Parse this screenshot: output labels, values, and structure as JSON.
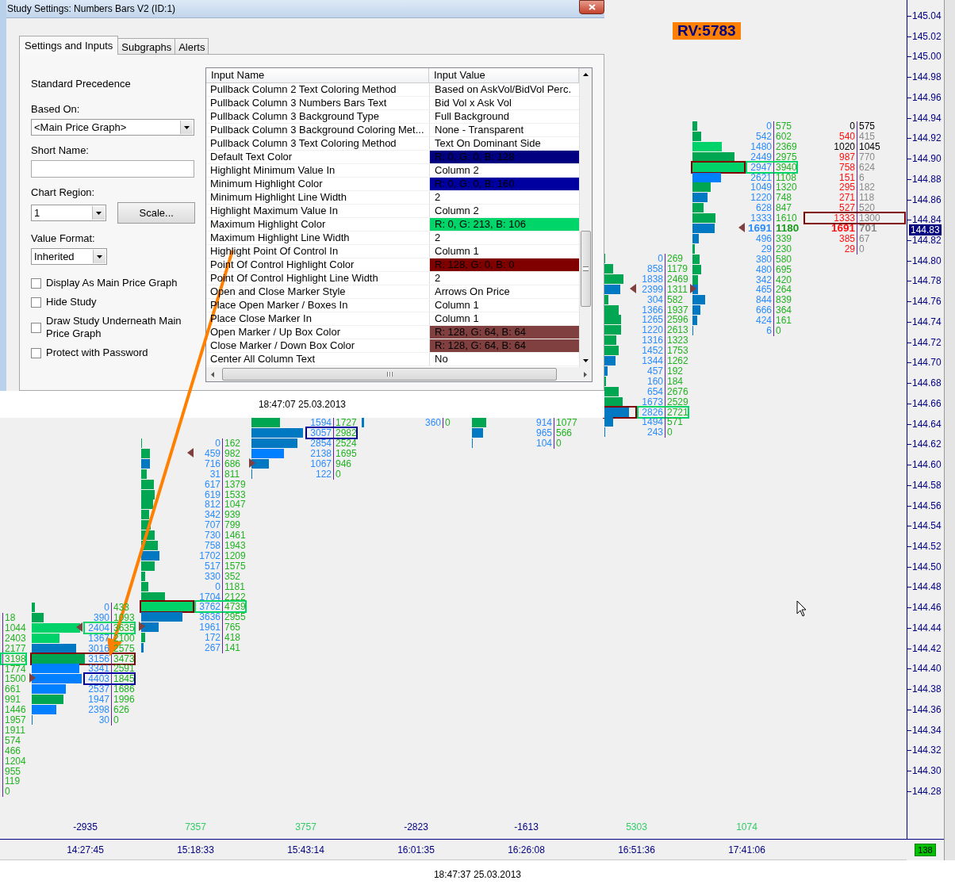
{
  "dialog": {
    "title": "Study Settings: Numbers Bars V2 (ID:1)",
    "tabs": [
      {
        "label": "Settings and Inputs",
        "selected": true
      },
      {
        "label": "Subgraphs",
        "selected": false
      },
      {
        "label": "Alerts",
        "selected": false
      }
    ],
    "form": {
      "heading": "Standard Precedence",
      "based_on": {
        "label": "Based On:",
        "value": "<Main Price Graph>"
      },
      "short_name": {
        "label": "Short Name:"
      },
      "chart_region": {
        "label": "Chart Region:",
        "value": "1"
      },
      "scale_button": "Scale...",
      "value_format": {
        "label": "Value Format:",
        "value": "Inherited"
      },
      "checkboxes": [
        {
          "label": "Display As Main Price Graph",
          "checked": false
        },
        {
          "label": "Hide Study",
          "checked": false
        },
        {
          "label": "Draw Study Underneath Main Price Graph",
          "checked": false
        },
        {
          "label": "Protect with Password",
          "checked": false
        }
      ]
    },
    "inputs_table": {
      "columns": [
        "Input Name",
        "Input Value"
      ],
      "rows": [
        {
          "name": "Pullback Column 2 Text Coloring Method",
          "value": "Based on AskVol/BidVol Perc."
        },
        {
          "name": "Pullback Column 3 Numbers Bars Text",
          "value": "Bid Vol x Ask Vol"
        },
        {
          "name": "Pullback Column 3 Background Type",
          "value": "Full Background"
        },
        {
          "name": "Pullback Column 3 Background Coloring Met...",
          "value": "None - Transparent"
        },
        {
          "name": "Pullback Column 3 Text Coloring Method",
          "value": "Text On Dominant Side"
        },
        {
          "name": "Default Text Color",
          "value": "R: 0, G: 0, B: 128",
          "color": "#000080"
        },
        {
          "name": "Highlight Minimum Value In",
          "value": "Column 2"
        },
        {
          "name": "Minimum Highlight Color",
          "value": "R: 0, G: 0, B: 160",
          "color": "#0000a0"
        },
        {
          "name": "Minimum Highlight Line Width",
          "value": "2"
        },
        {
          "name": "Highlight Maximum Value In",
          "value": "Column 2"
        },
        {
          "name": "Maximum Highlight Color",
          "value": "R: 0, G: 213, B: 106",
          "color": "#00d56a"
        },
        {
          "name": "Maximum Highlight Line Width",
          "value": "2"
        },
        {
          "name": "Highlight Point Of Control In",
          "value": "Column 1"
        },
        {
          "name": "Point Of Control Highlight Color",
          "value": "R: 128, G: 0, B: 0",
          "color": "#800000"
        },
        {
          "name": "Point Of Control Highlight Line Width",
          "value": "2"
        },
        {
          "name": "Open and Close Marker Style",
          "value": "Arrows On Price"
        },
        {
          "name": "Place Open Marker / Boxes In",
          "value": "Column 1"
        },
        {
          "name": "Place Close Marker In",
          "value": "Column 1"
        },
        {
          "name": "Open Marker / Up Box Color",
          "value": "R: 128, G: 64, B: 64",
          "color": "#804040"
        },
        {
          "name": "Close Marker / Down Box Color",
          "value": "R: 128, G: 64, B: 64",
          "color": "#804040"
        },
        {
          "name": "Center All Column Text",
          "value": "No"
        }
      ]
    }
  },
  "band_time": "18:47:07 25.03.2013",
  "rv_label": "RV:5783",
  "chart": {
    "columns": [
      {
        "kind": "partial",
        "rows": [
          {
            "ask": "18"
          },
          {
            "ask": "1044"
          },
          {
            "ask": "2403"
          },
          {
            "ask": "2177"
          },
          {
            "ask": "3198",
            "max_box": true
          },
          {
            "ask": "1774"
          },
          {
            "ask": "1500"
          },
          {
            "ask": "661"
          },
          {
            "ask": "991"
          },
          {
            "ask": "1446"
          },
          {
            "ask": "1957"
          },
          {
            "ask": "1911"
          },
          {
            "ask": "574"
          },
          {
            "ask": "466"
          },
          {
            "ask": "1204"
          },
          {
            "ask": "955"
          },
          {
            "ask": "119"
          },
          {
            "ask": "0"
          }
        ]
      },
      {
        "kind": "volume",
        "rows": [
          {
            "bid": "0",
            "ask": "433"
          },
          {
            "bid": "390",
            "ask": "1093"
          },
          {
            "bid": "2404",
            "ask": "3635",
            "max_box": true,
            "close_marker": true
          },
          {
            "bid": "1367",
            "ask": "2100"
          },
          {
            "bid": "3016",
            "ask": "2575"
          },
          {
            "bid": "3156",
            "ask": "3473",
            "poc_box": true
          },
          {
            "bid": "3341",
            "ask": "2591"
          },
          {
            "bid": "4403",
            "ask": "1845",
            "min_box": true,
            "open_marker": true
          },
          {
            "bid": "2537",
            "ask": "1686"
          },
          {
            "bid": "1947",
            "ask": "1996"
          },
          {
            "bid": "2398",
            "ask": "626"
          },
          {
            "bid": "30",
            "ask": "0"
          }
        ]
      },
      {
        "kind": "volume",
        "rows": [
          {
            "bid": "0",
            "ask": "162"
          },
          {
            "bid": "459",
            "ask": "982",
            "close_marker": true
          },
          {
            "bid": "716",
            "ask": "686"
          },
          {
            "bid": "31",
            "ask": "811"
          },
          {
            "bid": "617",
            "ask": "1379"
          },
          {
            "bid": "619",
            "ask": "1533"
          },
          {
            "bid": "812",
            "ask": "1047"
          },
          {
            "bid": "342",
            "ask": "939"
          },
          {
            "bid": "707",
            "ask": "799"
          },
          {
            "bid": "730",
            "ask": "1461"
          },
          {
            "bid": "758",
            "ask": "1943"
          },
          {
            "bid": "1702",
            "ask": "1209"
          },
          {
            "bid": "517",
            "ask": "1575"
          },
          {
            "bid": "330",
            "ask": "352"
          },
          {
            "bid": "0",
            "ask": "1181"
          },
          {
            "bid": "1704",
            "ask": "2122"
          },
          {
            "bid": "3762",
            "ask": "4739",
            "poc_box": true,
            "max_box": true
          },
          {
            "bid": "3636",
            "ask": "2955"
          },
          {
            "bid": "1961",
            "ask": "765",
            "open_marker": true
          },
          {
            "bid": "172",
            "ask": "418"
          },
          {
            "bid": "267",
            "ask": "141"
          }
        ]
      },
      {
        "kind": "volume",
        "rows": [
          {
            "bid": "1594",
            "ask": "1727"
          },
          {
            "bid": "3057",
            "ask": "2982",
            "min_box": true
          },
          {
            "bid": "2854",
            "ask": "2524"
          },
          {
            "bid": "2138",
            "ask": "1695"
          },
          {
            "bid": "1067",
            "ask": "946",
            "open_marker": true
          },
          {
            "bid": "122",
            "ask": "0"
          }
        ]
      },
      {
        "kind": "volume",
        "rows": [
          {
            "bid": "360",
            "ask": "0"
          }
        ]
      },
      {
        "kind": "volume",
        "rows": [
          {
            "bid": "914",
            "ask": "1077"
          },
          {
            "bid": "965",
            "ask": "566"
          },
          {
            "bid": "104",
            "ask": "0"
          }
        ]
      },
      {
        "kind": "volume",
        "rows": [
          {
            "bid": "0",
            "ask": "269"
          },
          {
            "bid": "858",
            "ask": "1179"
          },
          {
            "bid": "1838",
            "ask": "2469"
          },
          {
            "bid": "2399",
            "ask": "1311",
            "close_marker": true
          },
          {
            "bid": "304",
            "ask": "582"
          },
          {
            "bid": "1366",
            "ask": "1937"
          },
          {
            "bid": "1265",
            "ask": "2596"
          },
          {
            "bid": "1220",
            "ask": "2613"
          },
          {
            "bid": "1316",
            "ask": "1323"
          },
          {
            "bid": "1452",
            "ask": "1753"
          },
          {
            "bid": "1344",
            "ask": "1262"
          },
          {
            "bid": "457",
            "ask": "192"
          },
          {
            "bid": "160",
            "ask": "184"
          },
          {
            "bid": "654",
            "ask": "2676"
          },
          {
            "bid": "1673",
            "ask": "2529"
          },
          {
            "bid": "2826",
            "ask": "2721",
            "poc_box": true,
            "max_box": true
          },
          {
            "bid": "1494",
            "ask": "571"
          },
          {
            "bid": "243",
            "ask": "0"
          }
        ]
      },
      {
        "kind": "volume",
        "rows": [
          {
            "bid": "0",
            "ask": "575"
          },
          {
            "bid": "542",
            "ask": "602"
          },
          {
            "bid": "1480",
            "ask": "2369"
          },
          {
            "bid": "2449",
            "ask": "2975"
          },
          {
            "bid": "2947",
            "ask": "3940",
            "poc_box": true,
            "max_box": true
          },
          {
            "bid": "2621",
            "ask": "1108"
          },
          {
            "bid": "1049",
            "ask": "1320"
          },
          {
            "bid": "1220",
            "ask": "748"
          },
          {
            "bid": "628",
            "ask": "847"
          },
          {
            "bid": "1333",
            "ask": "1610"
          },
          {
            "bid": "1691",
            "ask": "1180",
            "current": true,
            "close_marker": true
          },
          {
            "bid": "496",
            "ask": "339"
          },
          {
            "bid": "29",
            "ask": "230"
          },
          {
            "bid": "380",
            "ask": "580"
          },
          {
            "bid": "480",
            "ask": "695"
          },
          {
            "bid": "342",
            "ask": "420"
          },
          {
            "bid": "465",
            "ask": "264",
            "open_marker": true
          },
          {
            "bid": "844",
            "ask": "839"
          },
          {
            "bid": "666",
            "ask": "364"
          },
          {
            "bid": "424",
            "ask": "161"
          },
          {
            "bid": "6",
            "ask": "0"
          }
        ]
      },
      {
        "kind": "pullback",
        "rows": [
          {
            "bid": "0",
            "ask": "575",
            "neutral": true
          },
          {
            "bid": "540",
            "ask": "415"
          },
          {
            "bid": "1020",
            "ask": "1045",
            "neutral": true
          },
          {
            "bid": "987",
            "ask": "770"
          },
          {
            "bid": "758",
            "ask": "624"
          },
          {
            "bid": "151",
            "ask": "6"
          },
          {
            "bid": "295",
            "ask": "182"
          },
          {
            "bid": "271",
            "ask": "118"
          },
          {
            "bid": "527",
            "ask": "520"
          },
          {
            "bid": "1333",
            "ask": "1300",
            "poc_box": true
          },
          {
            "bid": "1691",
            "ask": "701",
            "current": true
          },
          {
            "bid": "385",
            "ask": "67"
          },
          {
            "bid": "29",
            "ask": "0"
          }
        ]
      }
    ],
    "delta_row": [
      {
        "text": "-2935",
        "color": "#000080"
      },
      {
        "text": "7357",
        "color": "#33cc66"
      },
      {
        "text": "3757",
        "color": "#33cc66"
      },
      {
        "text": "-2823",
        "color": "#000080"
      },
      {
        "text": "-1613",
        "color": "#000080"
      },
      {
        "text": "5303",
        "color": "#33cc66"
      },
      {
        "text": "1074",
        "color": "#33cc66"
      }
    ],
    "time_labels": [
      "14:27:45",
      "15:18:33",
      "15:43:14",
      "16:01:35",
      "16:26:08",
      "16:51:36",
      "17:41:06"
    ],
    "bar_count": "138"
  },
  "price_axis": {
    "labels": [
      "145.04",
      "145.02",
      "145.00",
      "144.98",
      "144.96",
      "144.94",
      "144.92",
      "144.90",
      "144.88",
      "144.86",
      "144.84",
      "144.82",
      "144.80",
      "144.78",
      "144.76",
      "144.74",
      "144.72",
      "144.70",
      "144.68",
      "144.66",
      "144.64",
      "144.62",
      "144.60",
      "144.58",
      "144.56",
      "144.54",
      "144.52",
      "144.50",
      "144.48",
      "144.46",
      "144.44",
      "144.42",
      "144.40",
      "144.38",
      "144.36",
      "144.34",
      "144.32",
      "144.30",
      "144.28"
    ],
    "current": "144.83"
  },
  "footer_time": "18:47:37 25.03.2013"
}
